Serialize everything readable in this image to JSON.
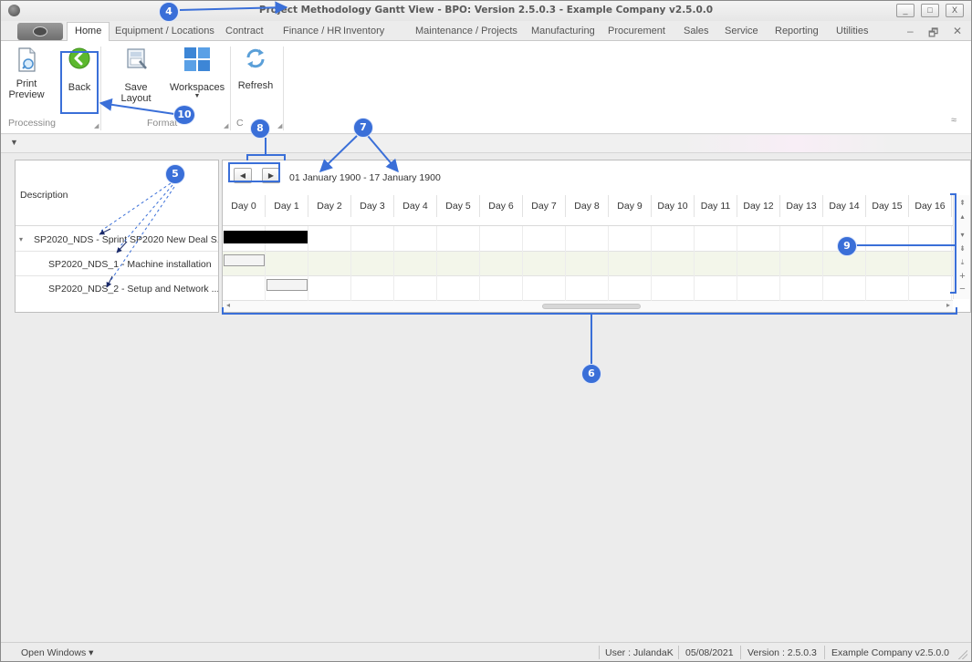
{
  "window": {
    "title": "Project Methodology Gantt View - BPO: Version 2.5.0.3 - Example Company v2.5.0.0",
    "controls": [
      "_",
      "□",
      "X"
    ]
  },
  "ribbon_tabs": [
    {
      "label": "Home",
      "active": true
    },
    {
      "label": "Equipment / Locations"
    },
    {
      "label": "Contract"
    },
    {
      "label": "Finance / HR"
    },
    {
      "label": "Inventory"
    },
    {
      "label": "Maintenance / Projects"
    },
    {
      "label": "Manufacturing"
    },
    {
      "label": "Procurement"
    },
    {
      "label": "Sales"
    },
    {
      "label": "Service"
    },
    {
      "label": "Reporting"
    },
    {
      "label": "Utilities"
    }
  ],
  "mdi_controls": [
    "–",
    "🗗",
    "✕"
  ],
  "ribbon": {
    "buttons": {
      "print_preview": "Print Preview",
      "back": "Back",
      "save_layout": "Save Layout",
      "workspaces": "Workspaces",
      "refresh": "Refresh"
    },
    "groups": {
      "processing": "Processing",
      "format": "Format",
      "current": "C"
    },
    "collapse_glyph": "≈"
  },
  "tree": {
    "header": "Description",
    "rows": [
      {
        "label": "SP2020_NDS - Sprint SP2020 New Deal S...",
        "expanded": true
      },
      {
        "label": "SP2020_NDS_1 - Machine installation"
      },
      {
        "label": "SP2020_NDS_2 - Setup and Network ..."
      }
    ]
  },
  "gantt": {
    "date_range": "01 January 1900 - 17 January 1900",
    "days": [
      "Day 0",
      "Day 1",
      "Day 2",
      "Day 3",
      "Day 4",
      "Day 5",
      "Day 6",
      "Day 7",
      "Day 8",
      "Day 9",
      "Day 10",
      "Day 11",
      "Day 12",
      "Day 13",
      "Day 14",
      "Day 15",
      "Day 16"
    ],
    "tasks": [
      {
        "row": 0,
        "start": 0,
        "end": 2,
        "kind": "summary"
      },
      {
        "row": 1,
        "start": 0,
        "end": 1,
        "kind": "task"
      },
      {
        "row": 2,
        "start": 1,
        "end": 2,
        "kind": "task"
      }
    ]
  },
  "status": {
    "open_windows": "Open Windows ▾",
    "user": "User : JulandaK",
    "date": "05/08/2021",
    "version": "Version : 2.5.0.3",
    "company": "Example Company v2.5.0.0"
  },
  "annotations": [
    "4",
    "5",
    "6",
    "7",
    "8",
    "9",
    "10"
  ],
  "colors": {
    "accent": "#3a6fd8",
    "alt_row": "#f3f6ea",
    "summary_bar": "#000000"
  }
}
